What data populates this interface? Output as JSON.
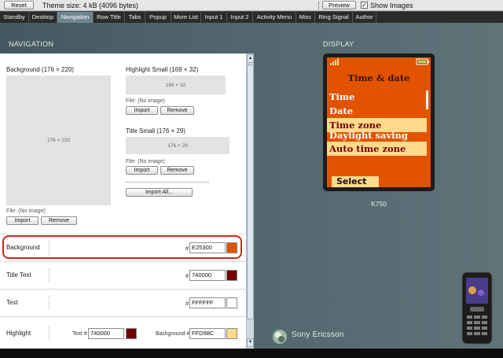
{
  "toolbar": {
    "reset_label": "Reset",
    "theme_size": "Theme size: 4 kB (4096 bytes)",
    "preview_label": "Preview",
    "show_images_label": "Show Images",
    "show_images_checked": true,
    "check_mark": "✓"
  },
  "tabs": [
    {
      "label": "Standby"
    },
    {
      "label": "Desktop"
    },
    {
      "label": "Navigation",
      "active": true
    },
    {
      "label": "Row Title"
    },
    {
      "label": "Tabs"
    },
    {
      "label": "Popup"
    },
    {
      "label": "More List"
    },
    {
      "label": "Input 1"
    },
    {
      "label": "Input 2"
    },
    {
      "label": "Activity Menu"
    },
    {
      "label": "Misc"
    },
    {
      "label": "Ring Signal"
    },
    {
      "label": "Author"
    }
  ],
  "navigation": {
    "heading": "NAVIGATION",
    "background_image": {
      "label": "Background (176 × 220)",
      "placeholder": "176 × 220",
      "file": "File: (No image)",
      "import_label": "Import",
      "remove_label": "Remove"
    },
    "highlight_small": {
      "label": "Highlight Small (169 × 32)",
      "placeholder": "169 × 32",
      "file": "File: (No image)",
      "import_label": "Import",
      "remove_label": "Remove"
    },
    "title_small": {
      "label": "Title Small (176 × 29)",
      "placeholder": "176 × 29",
      "file": "File: (No image)",
      "import_label": "Import",
      "remove_label": "Remove"
    },
    "import_all_label": "Import All...",
    "colors": {
      "background": {
        "label": "Background",
        "hash": "#",
        "value": "E25300",
        "swatch": "#E25300"
      },
      "title_text": {
        "label": "Title Text",
        "hash": "#",
        "value": "740000",
        "swatch": "#740000"
      },
      "text": {
        "label": "Text",
        "hash": "#",
        "value": "FFFFFF",
        "swatch": "#FFFFFF"
      },
      "highlight": {
        "label": "Highlight",
        "text_label": "Text #",
        "text_value": "740000",
        "text_swatch": "#740000",
        "bg_label": "Background #",
        "bg_value": "FFD98C",
        "bg_swatch": "#FFD98C"
      }
    }
  },
  "display": {
    "heading": "DISPLAY",
    "screen_title": "Time & date",
    "menu_items": [
      {
        "label": "Time"
      },
      {
        "label": "Date"
      },
      {
        "label": "Time zone",
        "highlighted": true
      },
      {
        "label": "Daylight saving"
      },
      {
        "label": "Auto time zone",
        "highlighted": true
      }
    ],
    "softkey": "Select",
    "model": "K750",
    "brand": "Sony Ericsson"
  },
  "icons": {
    "signal": "signal-icon",
    "battery": "battery-icon",
    "scroll_up": "▲",
    "scroll_down": "▼"
  }
}
